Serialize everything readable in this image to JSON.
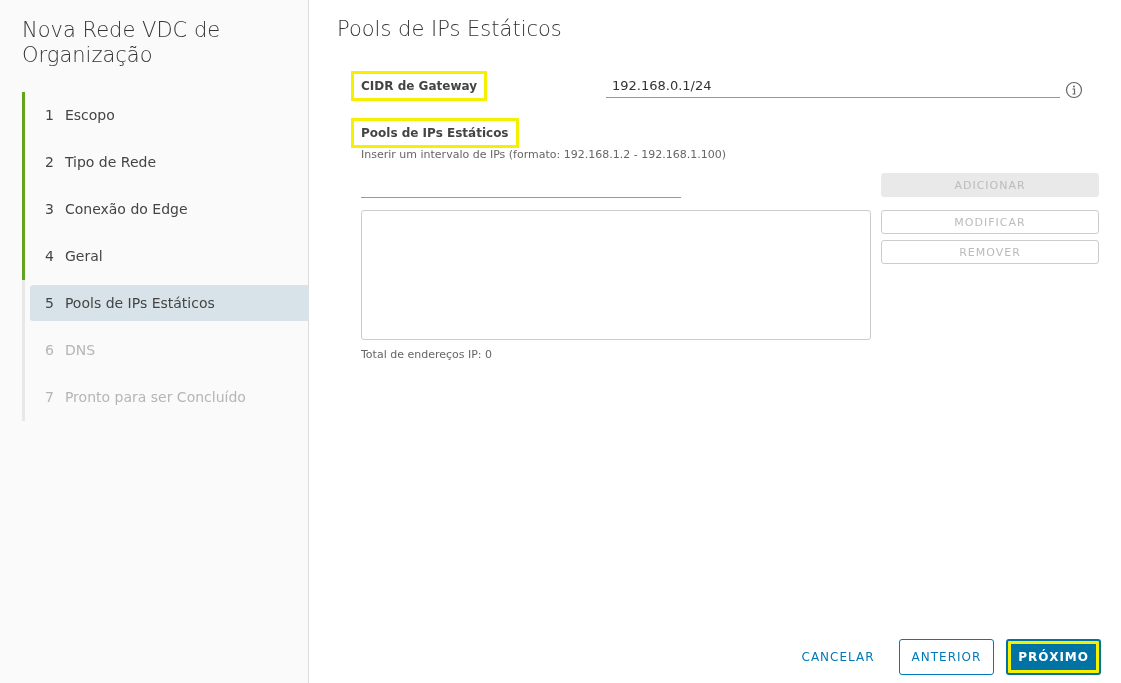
{
  "sidebar": {
    "title": "Nova Rede VDC de Organização",
    "steps": [
      {
        "number": "1",
        "label": "Escopo",
        "completed": true,
        "selected": false,
        "disabled": false
      },
      {
        "number": "2",
        "label": "Tipo de Rede",
        "completed": true,
        "selected": false,
        "disabled": false
      },
      {
        "number": "3",
        "label": "Conexão do Edge",
        "completed": true,
        "selected": false,
        "disabled": false
      },
      {
        "number": "4",
        "label": "Geral",
        "completed": true,
        "selected": false,
        "disabled": false
      },
      {
        "number": "5",
        "label": "Pools de IPs Estáticos",
        "completed": false,
        "selected": true,
        "disabled": false
      },
      {
        "number": "6",
        "label": "DNS",
        "completed": false,
        "selected": false,
        "disabled": true
      },
      {
        "number": "7",
        "label": "Pronto para ser Concluído",
        "completed": false,
        "selected": false,
        "disabled": true
      }
    ]
  },
  "page": {
    "title": "Pools de IPs Estáticos",
    "gateway": {
      "label": "CIDR de Gateway",
      "label_highlighted": true,
      "value": "192.168.0.1/24"
    },
    "pools": {
      "label": "Pools de IPs Estáticos",
      "label_highlighted": true,
      "hint": "Inserir um intervalo de IPs (formato: 192.168.1.2 - 192.168.1.100)",
      "buttons": [
        {
          "label": "ADICIONAR",
          "kind": "filled",
          "disabled": true
        },
        {
          "label": "MODIFICAR",
          "kind": "outline",
          "disabled": true
        },
        {
          "label": "REMOVER",
          "kind": "outline",
          "disabled": true
        }
      ],
      "total": "Total de endereços IP: 0"
    }
  },
  "footer": {
    "buttons": [
      {
        "label": "CANCELAR",
        "kind": "link",
        "highlighted": false
      },
      {
        "label": "ANTERIOR",
        "kind": "outline",
        "highlighted": false
      },
      {
        "label": "PRÓXIMO",
        "kind": "primary",
        "highlighted": true
      }
    ]
  }
}
